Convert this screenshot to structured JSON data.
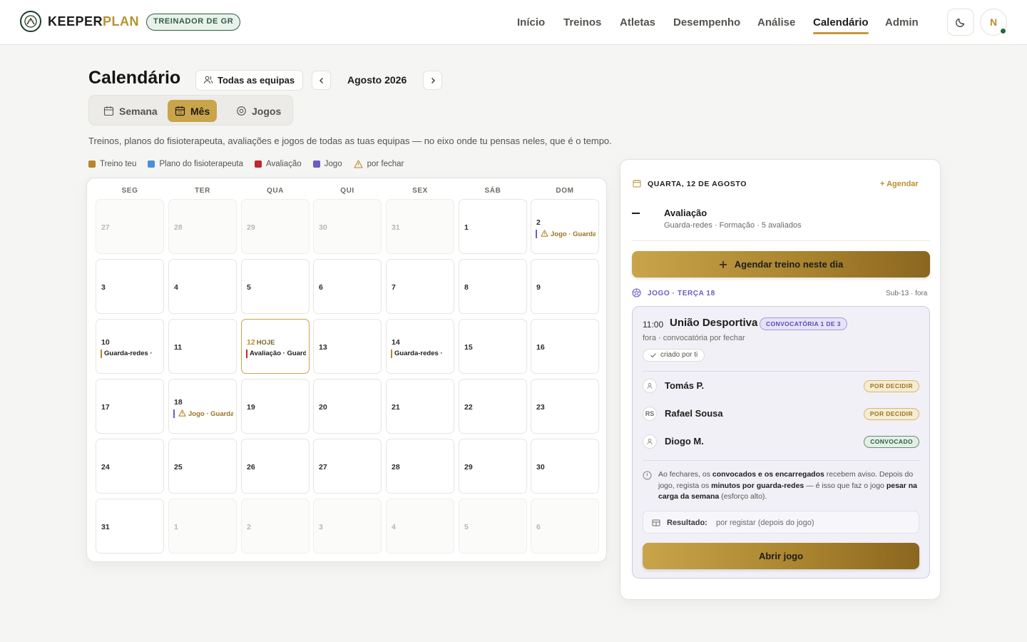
{
  "brand": {
    "name_a": "KEEPER",
    "name_b": "PLAN",
    "role": "TREINADOR DE GR"
  },
  "nav": [
    {
      "label": "Início"
    },
    {
      "label": "Treinos"
    },
    {
      "label": "Atletas"
    },
    {
      "label": "Desempenho"
    },
    {
      "label": "Análise"
    },
    {
      "label": "Calendário",
      "active": true
    },
    {
      "label": "Admin"
    }
  ],
  "user": {
    "initial": "N"
  },
  "page": {
    "title": "Calendário",
    "team_filter": "Todas as equipas",
    "month": "Agosto 2026",
    "views": [
      "Semana",
      "Mês",
      "Jogos"
    ],
    "active_view": "Mês",
    "description": "Treinos, planos do fisioterapeuta, avaliações e jogos de todas as tuas equipas — no eixo onde tu pensas neles, que é o tempo."
  },
  "legend": [
    {
      "label": "Treino teu",
      "color": "#b8862a"
    },
    {
      "label": "Plano do fisioterapeuta",
      "color": "#4a90d9"
    },
    {
      "label": "Avaliação",
      "color": "#c0262d"
    },
    {
      "label": "Jogo",
      "color": "#6c5bc4"
    },
    {
      "label": "por fechar",
      "icon": "warning-icon"
    }
  ],
  "calendar": {
    "weekdays": [
      "SEG",
      "TER",
      "QUA",
      "QUI",
      "SEX",
      "SÁB",
      "DOM"
    ],
    "today_label": "HOJE",
    "weeks": [
      [
        {
          "d": "27",
          "out": true
        },
        {
          "d": "28",
          "out": true
        },
        {
          "d": "29",
          "out": true
        },
        {
          "d": "30",
          "out": true
        },
        {
          "d": "31",
          "out": true
        },
        {
          "d": "1"
        },
        {
          "d": "2",
          "event": {
            "type": "jogo",
            "text": "Jogo · Guarda-redes",
            "warn": true
          }
        }
      ],
      [
        {
          "d": "3"
        },
        {
          "d": "4"
        },
        {
          "d": "5"
        },
        {
          "d": "6"
        },
        {
          "d": "7"
        },
        {
          "d": "8"
        },
        {
          "d": "9"
        }
      ],
      [
        {
          "d": "10",
          "event": {
            "type": "treino",
            "text": "Guarda-redes ·"
          }
        },
        {
          "d": "11"
        },
        {
          "d": "12",
          "today": true,
          "event": {
            "type": "aval",
            "text": "Avaliação · Guarda-redes"
          }
        },
        {
          "d": "13"
        },
        {
          "d": "14",
          "event": {
            "type": "treino",
            "text": "Guarda-redes ·"
          }
        },
        {
          "d": "15"
        },
        {
          "d": "16"
        }
      ],
      [
        {
          "d": "17"
        },
        {
          "d": "18",
          "event": {
            "type": "jogo",
            "text": "Jogo · Guarda-redes",
            "warn": true
          }
        },
        {
          "d": "19"
        },
        {
          "d": "20"
        },
        {
          "d": "21"
        },
        {
          "d": "22"
        },
        {
          "d": "23"
        }
      ],
      [
        {
          "d": "24"
        },
        {
          "d": "25"
        },
        {
          "d": "26"
        },
        {
          "d": "27"
        },
        {
          "d": "28"
        },
        {
          "d": "29"
        },
        {
          "d": "30"
        }
      ],
      [
        {
          "d": "31"
        },
        {
          "d": "1",
          "out": true
        },
        {
          "d": "2",
          "out": true
        },
        {
          "d": "3",
          "out": true
        },
        {
          "d": "4",
          "out": true
        },
        {
          "d": "5",
          "out": true
        },
        {
          "d": "6",
          "out": true
        }
      ]
    ]
  },
  "panel": {
    "date": "QUARTA, 12 DE AGOSTO",
    "agendar": "+ Agendar",
    "aval_title": "Avaliação",
    "aval_sub": "Guarda-redes · Formação · 5 avaliados",
    "schedule_btn": "Agendar treino neste dia",
    "jogo_head": "JOGO · TERÇA 18",
    "jogo_meta": "Sub-13 · fora",
    "game": {
      "time": "11:00",
      "team": "União Desportiva",
      "badge": "CONVOCATÓRIA 1 DE 3",
      "sub": "fora · convocatória por fechar",
      "chip": "criado por ti",
      "players": [
        {
          "name": "Tomás P.",
          "avatar": "",
          "status": "POR DECIDIR",
          "kind": "pend"
        },
        {
          "name": "Rafael Sousa",
          "avatar": "RS",
          "status": "POR DECIDIR",
          "kind": "pend"
        },
        {
          "name": "Diogo M.",
          "avatar": "",
          "status": "CONVOCADO",
          "kind": "conv"
        }
      ],
      "note_parts": [
        "Ao fechares, os ",
        "convocados e os encarregados",
        " recebem aviso. Depois do jogo, regista os ",
        "minutos por guarda-redes",
        " — é isso que faz o jogo ",
        "pesar na carga da semana",
        " (esforço alto)."
      ],
      "result_label": "Resultado:",
      "result_value": "por registar (depois do jogo)",
      "open_btn": "Abrir jogo"
    }
  }
}
